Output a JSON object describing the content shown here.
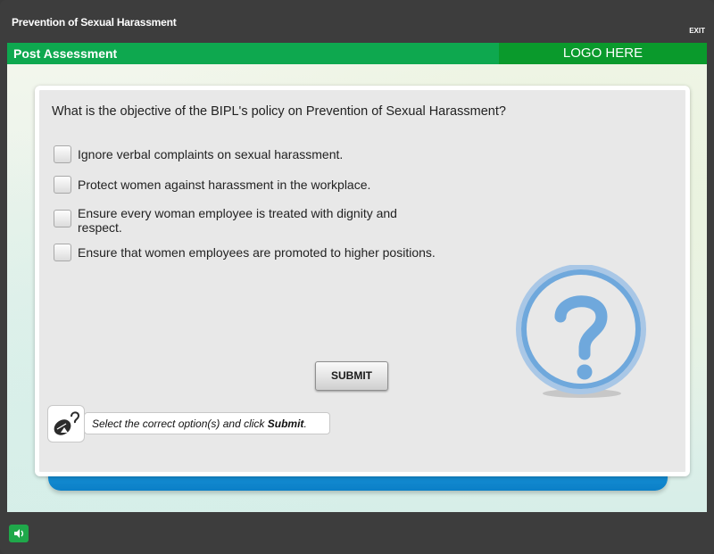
{
  "header": {
    "course_title": "Prevention of Sexual Harassment",
    "exit_label": "EXIT",
    "section_title": "Post Assessment",
    "logo_text": "LOGO HERE"
  },
  "question": {
    "text": "What is the objective of the BIPL's policy on Prevention of Sexual Harassment?",
    "options": [
      {
        "label": "Ignore verbal complaints on sexual harassment.",
        "checked": false
      },
      {
        "label": "Protect women against harassment in the workplace.",
        "checked": false
      },
      {
        "label": "Ensure every woman employee is treated with dignity and respect.",
        "checked": false
      },
      {
        "label": "Ensure that women employees are promoted to higher positions.",
        "checked": false
      }
    ]
  },
  "submit_label": "SUBMIT",
  "instruction": {
    "prefix": "Select the correct option(s) and click ",
    "emphasis": "Submit",
    "suffix": "."
  },
  "icons": {
    "question": "question-mark-icon",
    "hint": "mouse-click-icon",
    "sound": "speaker-icon"
  },
  "colors": {
    "accent_green": "#0ea84f",
    "logo_green": "#0a9a2c",
    "ribbon_blue": "#1f9de0",
    "question_icon_blue": "#6fa8dc"
  }
}
